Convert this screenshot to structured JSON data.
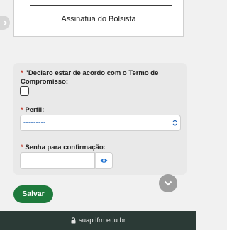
{
  "signature": {
    "label": "Assinatua do Bolsista"
  },
  "form": {
    "declaration": {
      "required_mark": "*",
      "label": "\"Declaro estar de acordo com o Termo de Compromisso:"
    },
    "perfil": {
      "required_mark": "*",
      "label": "Perfil:",
      "selected": "---------"
    },
    "senha": {
      "required_mark": "*",
      "label": "Senha para confirmação:"
    }
  },
  "actions": {
    "save_label": "Salvar"
  },
  "browser": {
    "url": "suap.ifrn.edu.br"
  },
  "icons": {
    "side_tab": "chevron-right-icon",
    "select_arrow": "updown-arrows-icon",
    "eye": "eye-icon",
    "scroll": "chevron-down-icon",
    "lock": "lock-icon"
  },
  "colors": {
    "save_button": "#1e7a3c",
    "required": "#c0392b",
    "select_value": "#1a5fb4",
    "eye_icon": "#1a6fd0",
    "url_bar": "#2b3a36"
  }
}
